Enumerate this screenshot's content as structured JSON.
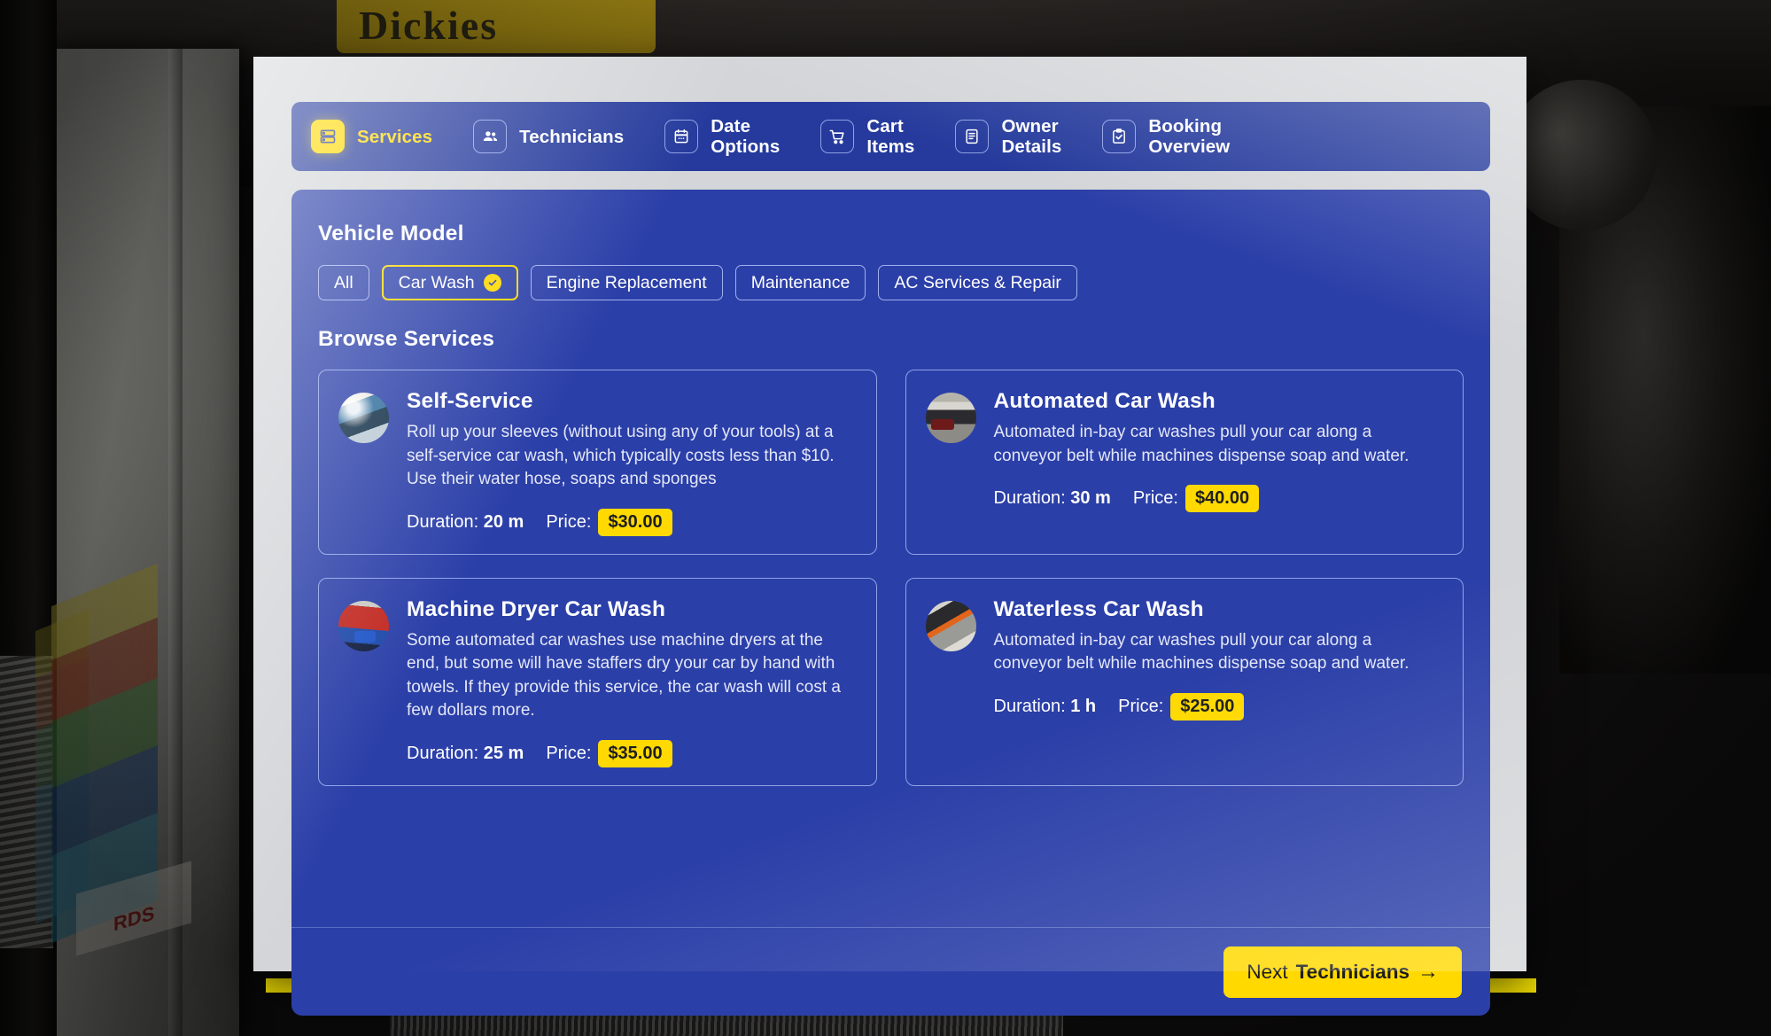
{
  "stepper": {
    "steps": [
      {
        "label": "Services",
        "icon": "services-icon",
        "active": true
      },
      {
        "label": "Technicians",
        "icon": "users-icon",
        "active": false
      },
      {
        "label": "Date\nOptions",
        "icon": "calendar-icon",
        "active": false
      },
      {
        "label": "Cart\nItems",
        "icon": "cart-icon",
        "active": false
      },
      {
        "label": "Owner\nDetails",
        "icon": "document-icon",
        "active": false
      },
      {
        "label": "Booking\nOverview",
        "icon": "clipboard-check-icon",
        "active": false
      }
    ]
  },
  "filters": {
    "title": "Vehicle Model",
    "chips": [
      {
        "label": "All",
        "selected": false
      },
      {
        "label": "Car Wash",
        "selected": true
      },
      {
        "label": "Engine Replacement",
        "selected": false
      },
      {
        "label": "Maintenance",
        "selected": false
      },
      {
        "label": "AC Services & Repair",
        "selected": false
      }
    ]
  },
  "browse": {
    "title": "Browse Services",
    "duration_label": "Duration:",
    "price_label": "Price:",
    "services": [
      {
        "name": "Self-Service",
        "description": "Roll up your sleeves (without using any of your tools) at a self-service car wash, which typically costs less than $10. Use their water hose, soaps and sponges",
        "duration": "20 m",
        "price": "$30.00",
        "thumb": "thumb-selfservice"
      },
      {
        "name": "Automated Car Wash",
        "description": "Automated in-bay car washes pull your car along a conveyor belt while machines dispense soap and water.",
        "duration": "30 m",
        "price": "$40.00",
        "thumb": "thumb-automated"
      },
      {
        "name": "Machine Dryer Car Wash",
        "description": "Some automated car washes use machine dryers at the end, but some will have staffers dry your car by hand with towels. If they provide this service, the car wash will cost a few dollars more.",
        "duration": "25 m",
        "price": "$35.00",
        "thumb": "thumb-dryer"
      },
      {
        "name": "Waterless Car Wash",
        "description": "Automated in-bay car washes pull your car along a conveyor belt while machines dispense soap and water.",
        "duration": "1 h",
        "price": "$25.00",
        "thumb": "thumb-waterless"
      }
    ]
  },
  "footer": {
    "next_prefix": "Next ",
    "next_target": "Technicians",
    "arrow": "→"
  },
  "colors": {
    "panel_blue": "#2b3fa8",
    "stepper_blue": "#253a9c",
    "accent_yellow": "#ffd900",
    "strip_yellow": "#f5e102",
    "card_border": "#8fa2e8",
    "outer_gray": "#d3d5d8"
  },
  "background": {
    "sign_text": "Dickies",
    "poster_text": "RDS"
  }
}
